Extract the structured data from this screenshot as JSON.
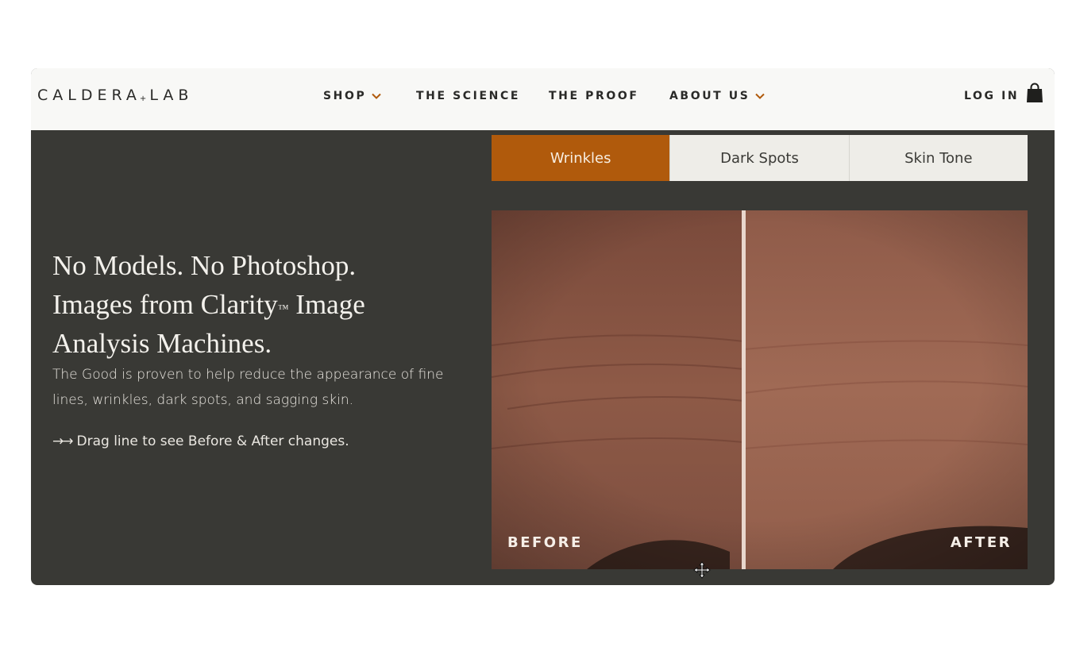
{
  "brand": {
    "logo_left": "CALDERA",
    "logo_plus": "+",
    "logo_right": "LAB"
  },
  "nav": {
    "items": [
      {
        "label": "SHOP",
        "has_dropdown": true
      },
      {
        "label": "THE SCIENCE",
        "has_dropdown": false
      },
      {
        "label": "THE PROOF",
        "has_dropdown": false
      },
      {
        "label": "ABOUT US",
        "has_dropdown": true
      }
    ],
    "login_label": "LOG IN",
    "cart_icon": "shopping-bag-icon"
  },
  "hero": {
    "headline_line1": "No Models. No Photoshop.",
    "headline_line2_a": "Images from Clarity",
    "headline_tm": "™",
    "headline_line2_b": " Image",
    "headline_line3": "Analysis Machines.",
    "body": "The Good is proven to help reduce the appearance of fine lines, wrinkles, dark spots, and sagging skin.",
    "drag_arrows": "→→",
    "drag_hint": "Drag line to see Before & After changes."
  },
  "tabs": [
    {
      "label": "Wrinkles",
      "active": true
    },
    {
      "label": "Dark Spots",
      "active": false
    },
    {
      "label": "Skin Tone",
      "active": false
    }
  ],
  "comparison": {
    "before_label": "BEFORE",
    "after_label": "AFTER",
    "slider_position": 0.47
  },
  "colors": {
    "accent": "#b05a0c",
    "panel_bg": "#393935",
    "nav_bg": "#f8f8f6",
    "chevron": "#b05a0c"
  }
}
